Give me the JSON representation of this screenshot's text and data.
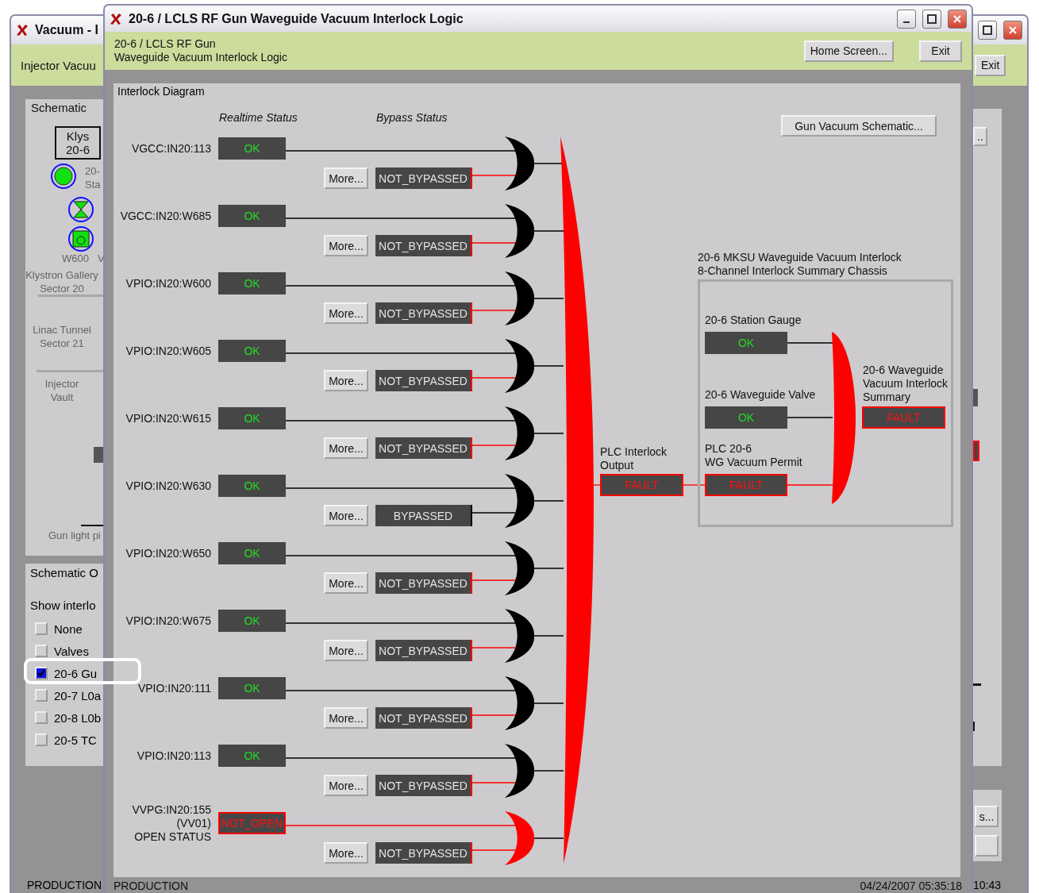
{
  "left_window": {
    "title": "Vacuum - I",
    "header": "Injector Vacuu",
    "schematic": {
      "tab": "Schematic",
      "klystron": [
        "Klys",
        "20-6"
      ],
      "gauge_label": [
        "20-",
        "Sta"
      ],
      "pump_label": "W600",
      "pump_label_2": "V",
      "areas": [
        [
          "Klystron Gallery",
          "Sector 20"
        ],
        [
          "Linac Tunnel",
          "Sector 21"
        ],
        [
          "Injector",
          "Vault"
        ]
      ],
      "pipe_label": "Gun light pi"
    },
    "options": {
      "title": "Schematic O",
      "prompt": "Show interlo",
      "items": [
        {
          "label": "None",
          "checked": false,
          "highlighted": false
        },
        {
          "label": "Valves",
          "checked": false,
          "highlighted": false
        },
        {
          "label": "20-6 Gu",
          "checked": true,
          "highlighted": true
        },
        {
          "label": "20-7 L0a",
          "checked": false,
          "highlighted": false
        },
        {
          "label": "20-8 L0b",
          "checked": false,
          "highlighted": false
        },
        {
          "label": "20-5 TC",
          "checked": false,
          "highlighted": false
        }
      ]
    },
    "status_bar": "PRODUCTION"
  },
  "window": {
    "title": "20-6 / LCLS RF Gun Waveguide Vacuum Interlock Logic",
    "header": [
      "20-6 / LCLS RF Gun",
      "Waveguide Vacuum Interlock Logic"
    ],
    "buttons": [
      "Home Screen...",
      "Exit"
    ],
    "diagram": {
      "title": "Interlock Diagram",
      "columns": [
        "Realtime Status",
        "Bypass Status"
      ],
      "schematic_button": "Gun Vacuum Schematic...",
      "channels": [
        {
          "label": [
            "VGCC:IN20:113"
          ],
          "status": "OK",
          "kind": "ok",
          "more": "More...",
          "bypass": "NOT_BYPASSED",
          "bypassed": false
        },
        {
          "label": [
            "VGCC:IN20:W685"
          ],
          "status": "OK",
          "kind": "ok",
          "more": "More...",
          "bypass": "NOT_BYPASSED",
          "bypassed": false
        },
        {
          "label": [
            "VPIO:IN20:W600"
          ],
          "status": "OK",
          "kind": "ok",
          "more": "More...",
          "bypass": "NOT_BYPASSED",
          "bypassed": false
        },
        {
          "label": [
            "VPIO:IN20:W605"
          ],
          "status": "OK",
          "kind": "ok",
          "more": "More...",
          "bypass": "NOT_BYPASSED",
          "bypassed": false
        },
        {
          "label": [
            "VPIO:IN20:W615"
          ],
          "status": "OK",
          "kind": "ok",
          "more": "More...",
          "bypass": "NOT_BYPASSED",
          "bypassed": false
        },
        {
          "label": [
            "VPIO:IN20:W630"
          ],
          "status": "OK",
          "kind": "ok",
          "more": "More...",
          "bypass": "BYPASSED",
          "bypassed": true
        },
        {
          "label": [
            "VPIO:IN20:W650"
          ],
          "status": "OK",
          "kind": "ok",
          "more": "More...",
          "bypass": "NOT_BYPASSED",
          "bypassed": false
        },
        {
          "label": [
            "VPIO:IN20:W675"
          ],
          "status": "OK",
          "kind": "ok",
          "more": "More...",
          "bypass": "NOT_BYPASSED",
          "bypassed": false
        },
        {
          "label": [
            "VPIO:IN20:111"
          ],
          "status": "OK",
          "kind": "ok",
          "more": "More...",
          "bypass": "NOT_BYPASSED",
          "bypassed": false
        },
        {
          "label": [
            "VPIO:IN20:113"
          ],
          "status": "OK",
          "kind": "ok",
          "more": "More...",
          "bypass": "NOT_BYPASSED",
          "bypassed": false
        },
        {
          "label": [
            "VVPG:IN20:155",
            "(VV01)",
            "OPEN STATUS"
          ],
          "status": "NOT_OPEN",
          "kind": "fault",
          "more": "More...",
          "bypass": "NOT_BYPASSED",
          "bypassed": false
        }
      ],
      "plc_output": {
        "label": [
          "PLC Interlock",
          "Output"
        ],
        "status": "FAULT",
        "kind": "fault"
      },
      "chassis": {
        "title": [
          "20-6 MKSU Waveguide Vacuum Interlock",
          "8-Channel Interlock Summary Chassis"
        ],
        "inputs": [
          {
            "label": [
              "20-6 Station Gauge"
            ],
            "status": "OK",
            "kind": "ok"
          },
          {
            "label": [
              "20-6 Waveguide Valve"
            ],
            "status": "OK",
            "kind": "ok"
          },
          {
            "label": [
              "PLC 20-6",
              "WG Vacuum Permit"
            ],
            "status": "FAULT",
            "kind": "fault"
          }
        ],
        "summary": {
          "label": [
            "20-6 Waveguide",
            "Vacuum Interlock",
            "Summary"
          ],
          "status": "FAULT",
          "kind": "fault"
        }
      }
    },
    "status_bar": {
      "mode": "PRODUCTION",
      "timestamp": "04/24/2007 05:35:18"
    }
  },
  "right_window": {
    "header_button": "Exit",
    "panel_button": "..",
    "bottom_button": "s...",
    "time": "10:43"
  }
}
